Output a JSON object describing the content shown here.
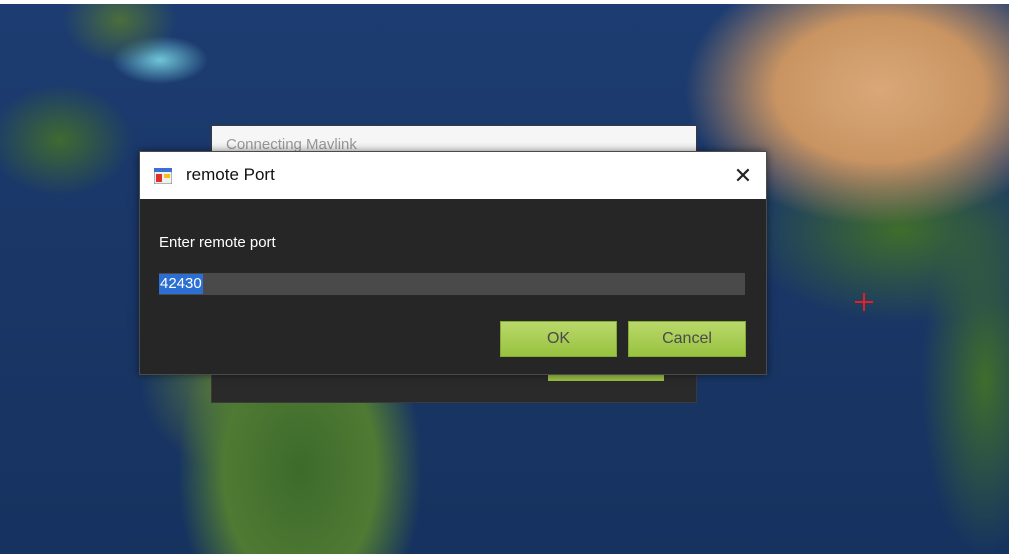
{
  "background_window": {
    "title": "Connecting Mavlink"
  },
  "dialog": {
    "title": "remote Port",
    "close_glyph": "✕",
    "prompt": "Enter remote port",
    "port_value": "42430",
    "ok_label": "OK",
    "cancel_label": "Cancel",
    "app_icon": "window-app-icon"
  },
  "colors": {
    "button_green": "#9bc443",
    "selection_blue": "#2a6fd1",
    "crosshair_red": "#e0202a",
    "dialog_bg": "#262626"
  }
}
